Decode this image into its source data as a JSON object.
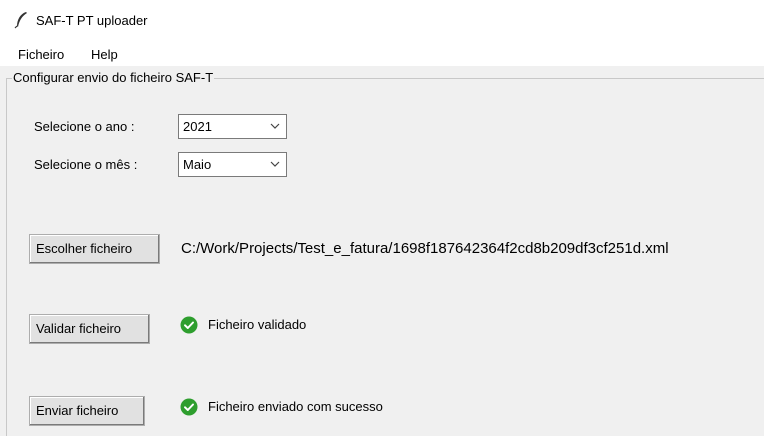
{
  "window": {
    "title": "SAF-T PT uploader",
    "icon": "feather-icon"
  },
  "menu": {
    "items": [
      {
        "label": "Ficheiro"
      },
      {
        "label": "Help"
      }
    ]
  },
  "config": {
    "group_title": "Configurar envio do ficheiro SAF-T",
    "year_label": "Selecione o ano :",
    "year_value": "2021",
    "month_label": "Selecione o mês :",
    "month_value": "Maio"
  },
  "actions": {
    "choose_file_label": "Escolher ficheiro",
    "file_path": "C:/Work/Projects/Test_e_fatura/1698f187642364f2cd8b209df3cf251d.xml",
    "validate_label": "Validar ficheiro",
    "validate_status": "Ficheiro validado",
    "send_label": "Enviar ficheiro",
    "send_status": "Ficheiro enviado com sucesso"
  },
  "colors": {
    "success": "#2e9e2e",
    "window_bg": "#f0f0f0",
    "button_bg": "#e1e1e1"
  }
}
